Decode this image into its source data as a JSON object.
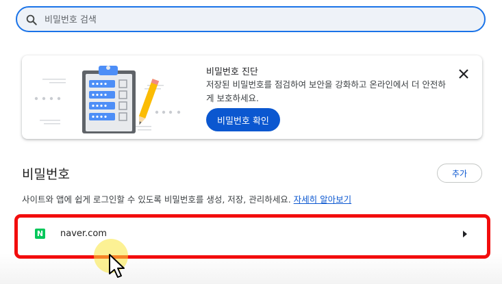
{
  "search": {
    "placeholder": "비밀번호 검색",
    "icon": "search-icon"
  },
  "checkup": {
    "title": "비밀번호 진단",
    "description": "저장된 비밀번호를 점검하여 보안을 강화하고 온라인에서 더 안전하게 보호하세요.",
    "button_label": "비밀번호 확인",
    "close_icon": "close-icon",
    "illustration": "clipboard-checklist-with-pencil"
  },
  "passwords": {
    "title": "비밀번호",
    "add_label": "추가",
    "description": "사이트와 앱에 쉽게 로그인할 수 있도록 비밀번호를 생성, 저장, 관리하세요.",
    "learn_more": "자세히 알아보기",
    "items": [
      {
        "site": "naver.com",
        "favicon_letter": "N",
        "favicon_color": "#03c75a"
      }
    ]
  },
  "colors": {
    "accent": "#0b57d0",
    "highlight": "#f20d0d",
    "search_border": "#1a73e8"
  }
}
